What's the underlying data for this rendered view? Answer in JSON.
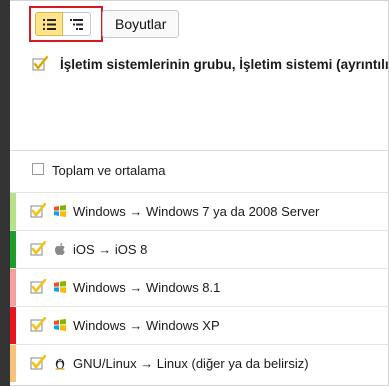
{
  "toolbar": {
    "dimensions_label": "Boyutlar",
    "view_toggle": {
      "selected": "flat-list",
      "options": [
        "flat-list-icon",
        "hierarchical-list-icon"
      ]
    }
  },
  "group": {
    "label": "İşletim sistemlerinin grubu, İşletim sistemi (ayrıntılı)",
    "checked": true
  },
  "totals": {
    "label": "Toplam ve ortalama",
    "checked": false
  },
  "rows": [
    {
      "label": "Windows → Windows 7 ya da 2008 Server",
      "icon": "windows-icon",
      "stripe": "#b7e08a",
      "checked": true
    },
    {
      "label": "iOS → iOS 8",
      "icon": "apple-icon",
      "stripe": "#1f9c2a",
      "checked": true
    },
    {
      "label": "Windows → Windows 8.1",
      "icon": "windows-icon",
      "stripe": "#f2a0a0",
      "checked": true
    },
    {
      "label": "Windows → Windows XP",
      "icon": "windows-icon",
      "stripe": "#e8141e",
      "checked": true
    },
    {
      "label": "GNU/Linux → Linux (diğer ya da belirsiz)",
      "icon": "linux-icon",
      "stripe": "#f5c27a",
      "checked": true
    }
  ],
  "colors": {
    "accent_selected": "#ffe58a",
    "highlight_border": "#d71921",
    "check_box": "#f0c419"
  }
}
